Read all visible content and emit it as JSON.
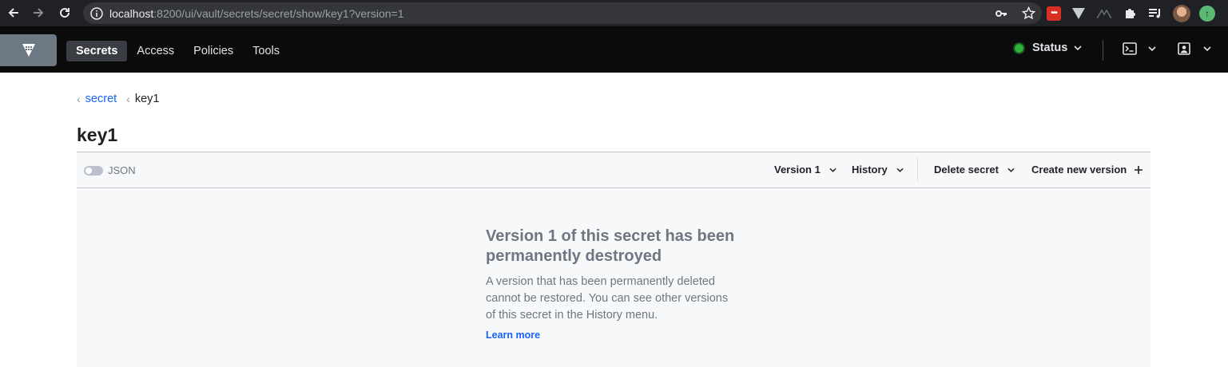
{
  "browser": {
    "url_host": "localhost",
    "url_rest": ":8200/ui/vault/secrets/secret/show/key1?version=1"
  },
  "nav": {
    "links": [
      {
        "label": "Secrets",
        "active": true
      },
      {
        "label": "Access",
        "active": false
      },
      {
        "label": "Policies",
        "active": false
      },
      {
        "label": "Tools",
        "active": false
      }
    ],
    "status_label": "Status",
    "status_color": "#2eb039"
  },
  "breadcrumb": {
    "parent": "secret",
    "current": "key1"
  },
  "page": {
    "title": "key1"
  },
  "toolbar": {
    "json_toggle_label": "JSON",
    "version_label": "Version 1",
    "history_label": "History",
    "delete_label": "Delete secret",
    "create_label": "Create new version"
  },
  "empty_state": {
    "title": "Version 1 of this secret has been permanently destroyed",
    "message": "A version that has been permanently deleted cannot be restored. You can see other versions of this secret in the History menu.",
    "link_label": "Learn more"
  },
  "colors": {
    "accent": "#1563ff",
    "nav_bg": "#0b0b0c",
    "toolbar_bg": "#f7f8fa"
  }
}
